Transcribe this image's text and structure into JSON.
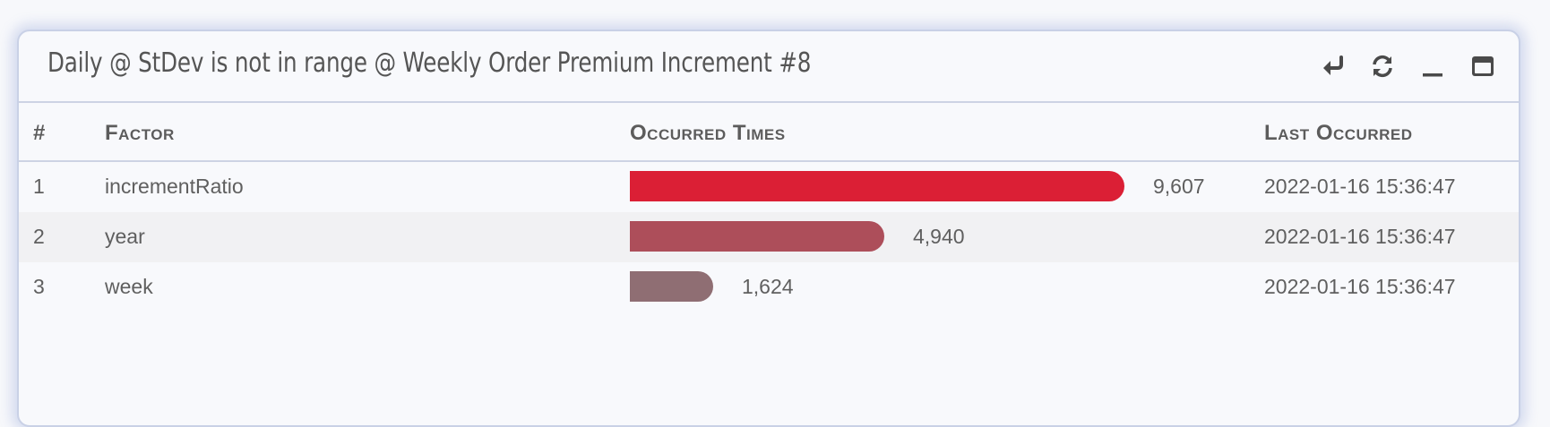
{
  "panel": {
    "title": "Daily @ StDev is not in range @ Weekly Order Premium Increment #8",
    "tools": [
      "return-icon",
      "refresh-icon",
      "minimize-icon",
      "maximize-icon"
    ]
  },
  "table": {
    "headers": {
      "index": "#",
      "factor": "Factor",
      "occurred": "Occurred Times",
      "last": "Last Occurred"
    },
    "rows": [
      {
        "index": "1",
        "factor": "incrementRatio",
        "count": 9607,
        "count_label": "9,607",
        "last": "2022-01-16 15:36:47",
        "color": "#db1f35"
      },
      {
        "index": "2",
        "factor": "year",
        "count": 4940,
        "count_label": "4,940",
        "last": "2022-01-16 15:36:47",
        "color": "#ad4e5a"
      },
      {
        "index": "3",
        "factor": "week",
        "count": 1624,
        "count_label": "1,624",
        "last": "2022-01-16 15:36:47",
        "color": "#8f6e73"
      }
    ]
  },
  "chart_data": {
    "type": "bar",
    "categories": [
      "incrementRatio",
      "year",
      "week"
    ],
    "values": [
      9607,
      4940,
      1624
    ],
    "title": "",
    "xlabel": "Occurred Times",
    "ylabel": "Factor"
  }
}
